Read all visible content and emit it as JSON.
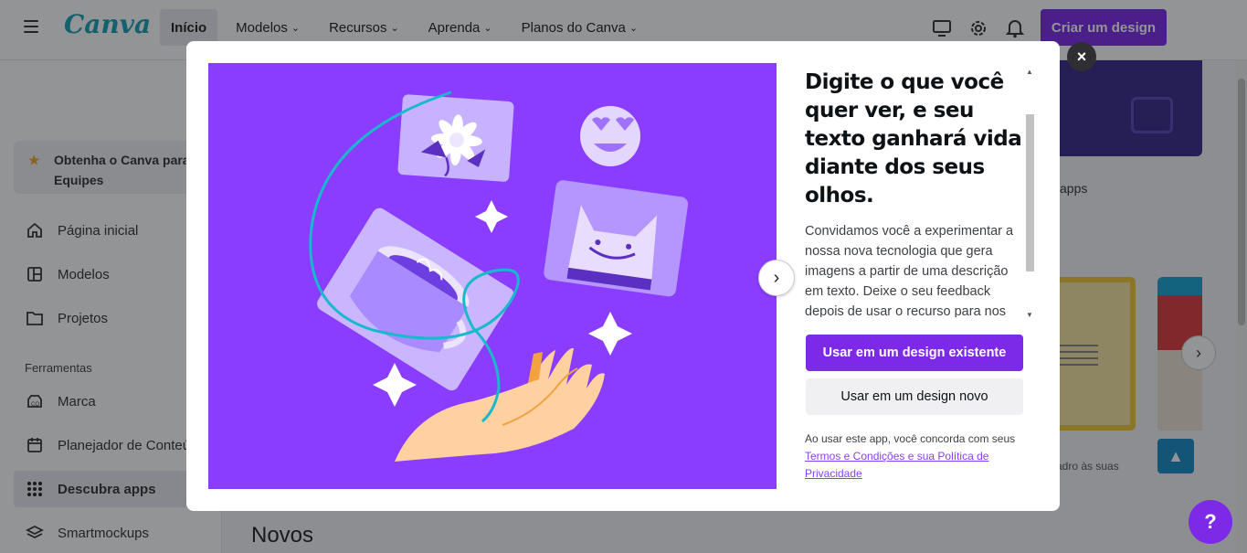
{
  "app": {
    "logo_text": "Canva"
  },
  "header": {
    "nav": [
      {
        "label": "Início",
        "has_dropdown": false
      },
      {
        "label": "Modelos",
        "has_dropdown": true
      },
      {
        "label": "Recursos",
        "has_dropdown": true
      },
      {
        "label": "Aprenda",
        "has_dropdown": true
      },
      {
        "label": "Planos do Canva",
        "has_dropdown": true
      }
    ],
    "icons": [
      "monitor-icon",
      "gear-icon",
      "bell-icon"
    ],
    "create_button": "Criar um design"
  },
  "sidebar": {
    "teams_promo": "Obtenha o Canva para Equipes",
    "items_top": [
      {
        "label": "Página inicial",
        "icon": "home-icon"
      },
      {
        "label": "Modelos",
        "icon": "templates-icon"
      },
      {
        "label": "Projetos",
        "icon": "folder-icon"
      }
    ],
    "section_label": "Ferramentas",
    "items_tools": [
      {
        "label": "Marca",
        "icon": "brand-icon"
      },
      {
        "label": "Planejador de Conteúdo",
        "icon": "calendar-icon"
      },
      {
        "label": "Descubra apps",
        "icon": "apps-grid-icon",
        "active": true
      },
      {
        "label": "Smartmockups",
        "icon": "layers-icon"
      }
    ]
  },
  "background": {
    "apps_text": "apps",
    "caption": "adro às suas",
    "section_title": "Novos",
    "help_label": "?"
  },
  "modal": {
    "title": "Digite o que você quer ver, e seu texto ganhará vida diante dos seus olhos.",
    "body": "Convidamos você a experimentar a nossa nova tecnologia que gera imagens a partir de uma descrição em texto. Deixe o seu feedback depois de usar o recurso para nos",
    "primary_button": "Usar em um design existente",
    "secondary_button": "Usar em um design novo",
    "terms_prefix": "Ao usar este app, você concorda com seus ",
    "terms_link": "Termos e Condições e sua Política de Privacidade",
    "close_label": "×",
    "colors": {
      "accent": "#7d2ae8",
      "illustration_bg": "#8b3dff"
    }
  }
}
